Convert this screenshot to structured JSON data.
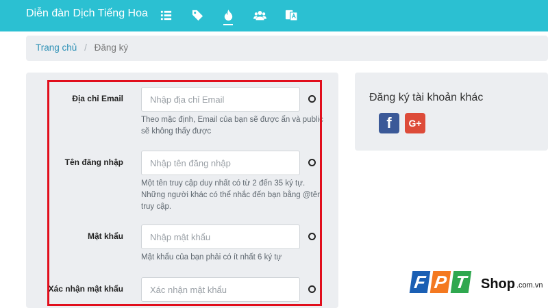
{
  "header": {
    "brand": "Diễn đàn Dịch Tiếng Hoa",
    "nav_icons": [
      "list-icon",
      "tags-icon",
      "fire-icon",
      "users-icon",
      "translate-icon"
    ]
  },
  "breadcrumb": {
    "home": "Trang chủ",
    "separator": "/",
    "current": "Đăng ký"
  },
  "form": {
    "fields": [
      {
        "label": "Địa chỉ Email",
        "placeholder": "Nhập địa chỉ Email",
        "help": "Theo mặc định, Email của bạn sẽ được ẩn và public sẽ không thấy được"
      },
      {
        "label": "Tên đăng nhập",
        "placeholder": "Nhập tên đăng nhập",
        "help": "Một tên truy cập duy nhất có từ 2 đến 35 ký tự. Những người khác có thể nhắc đến bạn bằng @tên truy cập."
      },
      {
        "label": "Mật khẩu",
        "placeholder": "Nhập mật khẩu",
        "help": "Mật khẩu của bạn phải có ít nhất 6 ký tự"
      },
      {
        "label": "Xác nhận mật khẩu",
        "placeholder": "Xác nhận mật khẩu",
        "help": ""
      }
    ]
  },
  "sidebar": {
    "title": "Đăng ký tài khoản khác",
    "facebook_label": "f",
    "google_label": "G+"
  },
  "watermark": {
    "letters": [
      "F",
      "P",
      "T"
    ],
    "shop": "Shop",
    "domain": ".com.vn"
  },
  "colors": {
    "header": "#2bc0d2",
    "panel": "#eceef1",
    "highlight": "#e10e1c",
    "facebook": "#3b5998",
    "google": "#dd4b39",
    "fpt_blue": "#1a5fb4",
    "fpt_orange": "#f47920",
    "fpt_green": "#2fa84f"
  }
}
